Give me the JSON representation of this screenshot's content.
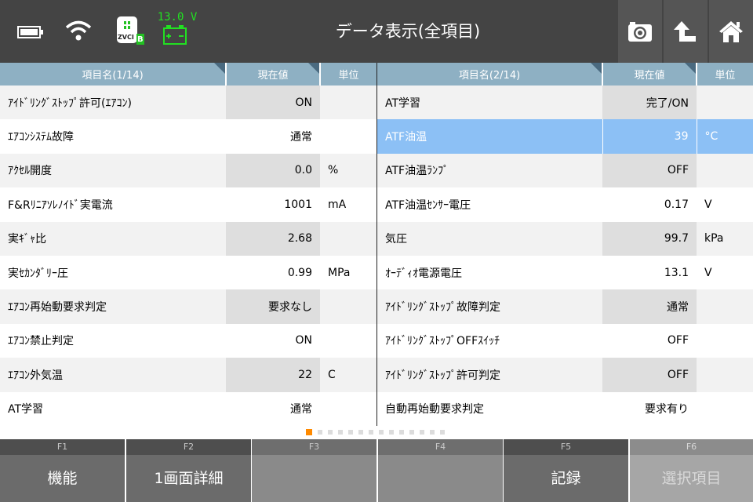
{
  "header": {
    "title": "データ表示(全項目)",
    "voltage": "13.0 V",
    "vci_label": "ZVCI",
    "vci_badge": "B",
    "icons": [
      "battery-icon",
      "wifi-icon",
      "vci-icon",
      "car-battery-icon",
      "camera-icon",
      "back-icon",
      "home-icon"
    ]
  },
  "left_table": {
    "columns": [
      "項目名(1/14)",
      "現在値",
      "単位"
    ],
    "rows": [
      {
        "name": "ｱｲﾄﾞﾘﾝｸﾞｽﾄｯﾌﾟ許可(ｴｱｺﾝ)",
        "value": "ON",
        "unit": ""
      },
      {
        "name": "ｴｱｺﾝｼｽﾃﾑ故障",
        "value": "通常",
        "unit": ""
      },
      {
        "name": "ｱｸｾﾙ開度",
        "value": "0.0",
        "unit": "%"
      },
      {
        "name": "F&Rﾘﾆｱｿﾚﾉｲﾄﾞ実電流",
        "value": "1001",
        "unit": "mA"
      },
      {
        "name": "実ｷﾞｬ比",
        "value": "2.68",
        "unit": ""
      },
      {
        "name": "実ｾｶﾝﾀﾞﾘｰ圧",
        "value": "0.99",
        "unit": "MPa"
      },
      {
        "name": "ｴｱｺﾝ再始動要求判定",
        "value": "要求なし",
        "unit": ""
      },
      {
        "name": "ｴｱｺﾝ禁止判定",
        "value": "ON",
        "unit": ""
      },
      {
        "name": "ｴｱｺﾝ外気温",
        "value": "22",
        "unit": "C"
      },
      {
        "name": "AT学習",
        "value": "通常",
        "unit": ""
      }
    ]
  },
  "right_table": {
    "columns": [
      "項目名(2/14)",
      "現在値",
      "単位"
    ],
    "rows": [
      {
        "name": "AT学習",
        "value": "完了/ON",
        "unit": ""
      },
      {
        "name": "ATF油温",
        "value": "39",
        "unit": "°C"
      },
      {
        "name": "ATF油温ﾗﾝﾌﾟ",
        "value": "OFF",
        "unit": ""
      },
      {
        "name": "ATF油温ｾﾝｻｰ電圧",
        "value": "0.17",
        "unit": "V"
      },
      {
        "name": "気圧",
        "value": "99.7",
        "unit": "kPa"
      },
      {
        "name": "ｵｰﾃﾞｨｵ電源電圧",
        "value": "13.1",
        "unit": "V"
      },
      {
        "name": "ｱｲﾄﾞﾘﾝｸﾞｽﾄｯﾌﾟ故障判定",
        "value": "通常",
        "unit": ""
      },
      {
        "name": "ｱｲﾄﾞﾘﾝｸﾞｽﾄｯﾌﾟOFFｽｲｯﾁ",
        "value": "OFF",
        "unit": ""
      },
      {
        "name": "ｱｲﾄﾞﾘﾝｸﾞｽﾄｯﾌﾟ許可判定",
        "value": "OFF",
        "unit": ""
      },
      {
        "name": "自動再始動要求判定",
        "value": "要求有り",
        "unit": ""
      }
    ],
    "selected_row": 1
  },
  "pager": {
    "page_count": 14,
    "active_page": 1
  },
  "function_keys": [
    {
      "key": "F1",
      "label": "機能",
      "state": "enabled"
    },
    {
      "key": "F2",
      "label": "1画面詳細",
      "state": "enabled"
    },
    {
      "key": "F3",
      "label": "",
      "state": "empty"
    },
    {
      "key": "F4",
      "label": "",
      "state": "empty"
    },
    {
      "key": "F5",
      "label": "記録",
      "state": "enabled"
    },
    {
      "key": "F6",
      "label": "選択項目",
      "state": "disabled"
    }
  ],
  "colors": {
    "topbar": "#444444",
    "header_cell": "#8eb0c3",
    "selected_row": "#8cc0f5",
    "pager_active": "#ff8a00",
    "voltage_text": "#22e022"
  }
}
